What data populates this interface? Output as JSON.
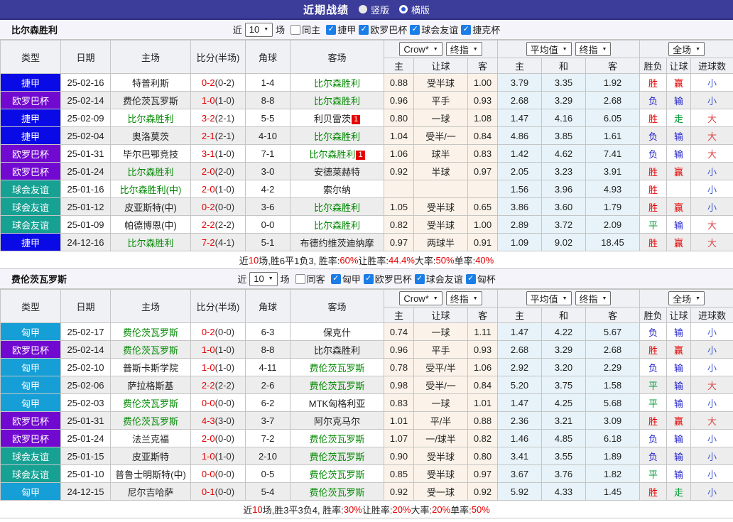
{
  "titlebar": {
    "title": "近期战绩",
    "radio_vertical": "竖版",
    "radio_horizontal": "横版",
    "selected": "横版"
  },
  "palette": {
    "titlebar_bg": "#3c3c9a",
    "focal_green": "#008800",
    "score_red": "#e60000",
    "checkbox_blue": "#1b7de6",
    "handicap_bg": "#fbf3e9",
    "avg_bg": "#e7f3f9"
  },
  "type_colors": {
    "捷甲": "#0a0ae6",
    "欧罗巴杯": "#7209d0",
    "球会友谊": "#16a193",
    "匈甲": "#169fd6"
  },
  "result_colors": {
    "胜": "#e60000",
    "赢": "#e60000",
    "大": "#e04545",
    "负": "#2222cc",
    "输": "#2222cc",
    "小": "#3b55d4",
    "平": "#009933",
    "走": "#009933"
  },
  "table_headers": {
    "type": "类型",
    "date": "日期",
    "home": "主场",
    "score": "比分(半场)",
    "corner": "角球",
    "away": "客场",
    "selects": {
      "crow": "Crow*",
      "final1": "终指",
      "avg": "平均值",
      "final2": "终指",
      "full": "全场"
    },
    "sub": [
      "主",
      "让球",
      "客",
      "主",
      "和",
      "客",
      "胜负",
      "让球",
      "进球数"
    ]
  },
  "filter_labels": {
    "near": "近",
    "count": "10",
    "matches": "场"
  },
  "sections": [
    {
      "team": "比尔森胜利",
      "filter": {
        "same_label": "同主",
        "same_checked": false,
        "leagues": [
          {
            "label": "捷甲",
            "checked": true
          },
          {
            "label": "欧罗巴杯",
            "checked": true
          },
          {
            "label": "球会友谊",
            "checked": true
          },
          {
            "label": "捷克杯",
            "checked": true
          }
        ]
      },
      "rows": [
        {
          "type": "捷甲",
          "date": "25-02-16",
          "home": "特普利斯",
          "home_focal": false,
          "score": "0-2",
          "half": "(0-2)",
          "corner": "1-4",
          "away": "比尔森胜利",
          "away_focal": true,
          "away_badge": "",
          "odds": [
            "0.88",
            "受半球",
            "1.00"
          ],
          "avg": [
            "3.79",
            "3.35",
            "1.92"
          ],
          "results": [
            "胜",
            "赢",
            "小"
          ]
        },
        {
          "type": "欧罗巴杯",
          "date": "25-02-14",
          "home": "费伦茨瓦罗斯",
          "home_focal": false,
          "score": "1-0",
          "half": "(1-0)",
          "corner": "8-8",
          "away": "比尔森胜利",
          "away_focal": true,
          "away_badge": "",
          "odds": [
            "0.96",
            "平手",
            "0.93"
          ],
          "avg": [
            "2.68",
            "3.29",
            "2.68"
          ],
          "results": [
            "负",
            "输",
            "小"
          ]
        },
        {
          "type": "捷甲",
          "date": "25-02-09",
          "home": "比尔森胜利",
          "home_focal": true,
          "score": "3-2",
          "half": "(2-1)",
          "corner": "5-5",
          "away": "利贝雷茨",
          "away_focal": false,
          "away_badge": "1",
          "odds": [
            "0.80",
            "一球",
            "1.08"
          ],
          "avg": [
            "1.47",
            "4.16",
            "6.05"
          ],
          "results": [
            "胜",
            "走",
            "大"
          ]
        },
        {
          "type": "捷甲",
          "date": "25-02-04",
          "home": "奥洛莫茨",
          "home_focal": false,
          "score": "2-1",
          "half": "(2-1)",
          "corner": "4-10",
          "away": "比尔森胜利",
          "away_focal": true,
          "away_badge": "",
          "odds": [
            "1.04",
            "受半/一",
            "0.84"
          ],
          "avg": [
            "4.86",
            "3.85",
            "1.61"
          ],
          "results": [
            "负",
            "输",
            "大"
          ]
        },
        {
          "type": "欧罗巴杯",
          "date": "25-01-31",
          "home": "毕尔巴鄂竞技",
          "home_focal": false,
          "score": "3-1",
          "half": "(1-0)",
          "corner": "7-1",
          "away": "比尔森胜利",
          "away_focal": true,
          "away_badge": "1",
          "odds": [
            "1.06",
            "球半",
            "0.83"
          ],
          "avg": [
            "1.42",
            "4.62",
            "7.41"
          ],
          "results": [
            "负",
            "输",
            "大"
          ]
        },
        {
          "type": "欧罗巴杯",
          "date": "25-01-24",
          "home": "比尔森胜利",
          "home_focal": true,
          "score": "2-0",
          "half": "(2-0)",
          "corner": "3-0",
          "away": "安德莱赫特",
          "away_focal": false,
          "away_badge": "",
          "odds": [
            "0.92",
            "半球",
            "0.97"
          ],
          "avg": [
            "2.05",
            "3.23",
            "3.91"
          ],
          "results": [
            "胜",
            "赢",
            "小"
          ]
        },
        {
          "type": "球会友谊",
          "date": "25-01-16",
          "home": "比尔森胜利(中)",
          "home_focal": true,
          "score": "2-0",
          "half": "(1-0)",
          "corner": "4-2",
          "away": "索尔纳",
          "away_focal": false,
          "away_badge": "",
          "odds": [
            "",
            "",
            ""
          ],
          "avg": [
            "1.56",
            "3.96",
            "4.93"
          ],
          "results": [
            "胜",
            "",
            "小"
          ]
        },
        {
          "type": "球会友谊",
          "date": "25-01-12",
          "home": "皮亚斯特(中)",
          "home_focal": false,
          "score": "0-2",
          "half": "(0-0)",
          "corner": "3-6",
          "away": "比尔森胜利",
          "away_focal": true,
          "away_badge": "",
          "odds": [
            "1.05",
            "受半球",
            "0.65"
          ],
          "avg": [
            "3.86",
            "3.60",
            "1.79"
          ],
          "results": [
            "胜",
            "赢",
            "小"
          ]
        },
        {
          "type": "球会友谊",
          "date": "25-01-09",
          "home": "帕德博恩(中)",
          "home_focal": false,
          "score": "2-2",
          "half": "(2-2)",
          "corner": "0-0",
          "away": "比尔森胜利",
          "away_focal": true,
          "away_badge": "",
          "odds": [
            "0.82",
            "受半球",
            "1.00"
          ],
          "avg": [
            "2.89",
            "3.72",
            "2.09"
          ],
          "results": [
            "平",
            "输",
            "大"
          ]
        },
        {
          "type": "捷甲",
          "date": "24-12-16",
          "home": "比尔森胜利",
          "home_focal": true,
          "score": "7-2",
          "half": "(4-1)",
          "corner": "5-1",
          "away": "布德约维茨迪纳摩",
          "away_focal": false,
          "away_badge": "",
          "odds": [
            "0.97",
            "两球半",
            "0.91"
          ],
          "avg": [
            "1.09",
            "9.02",
            "18.45"
          ],
          "results": [
            "胜",
            "赢",
            "大"
          ]
        }
      ],
      "summary": [
        {
          "text": "近",
          "red": false
        },
        {
          "text": "10",
          "red": true
        },
        {
          "text": "场,胜6平1负3, 胜率:",
          "red": false
        },
        {
          "text": "60%",
          "red": true
        },
        {
          "text": " 让胜率:",
          "red": false
        },
        {
          "text": "44.4%",
          "red": true
        },
        {
          "text": " 大率:",
          "red": false
        },
        {
          "text": "50%",
          "red": true
        },
        {
          "text": " 单率:",
          "red": false
        },
        {
          "text": "40%",
          "red": true
        }
      ]
    },
    {
      "team": "费伦茨瓦罗斯",
      "filter": {
        "same_label": "同客",
        "same_checked": false,
        "leagues": [
          {
            "label": "匈甲",
            "checked": true
          },
          {
            "label": "欧罗巴杯",
            "checked": true
          },
          {
            "label": "球会友谊",
            "checked": true
          },
          {
            "label": "匈杯",
            "checked": true
          }
        ]
      },
      "rows": [
        {
          "type": "匈甲",
          "date": "25-02-17",
          "home": "费伦茨瓦罗斯",
          "home_focal": true,
          "score": "0-2",
          "half": "(0-0)",
          "corner": "6-3",
          "away": "保克什",
          "away_focal": false,
          "away_badge": "",
          "odds": [
            "0.74",
            "一球",
            "1.11"
          ],
          "avg": [
            "1.47",
            "4.22",
            "5.67"
          ],
          "results": [
            "负",
            "输",
            "小"
          ]
        },
        {
          "type": "欧罗巴杯",
          "date": "25-02-14",
          "home": "费伦茨瓦罗斯",
          "home_focal": true,
          "score": "1-0",
          "half": "(1-0)",
          "corner": "8-8",
          "away": "比尔森胜利",
          "away_focal": false,
          "away_badge": "",
          "odds": [
            "0.96",
            "平手",
            "0.93"
          ],
          "avg": [
            "2.68",
            "3.29",
            "2.68"
          ],
          "results": [
            "胜",
            "赢",
            "小"
          ]
        },
        {
          "type": "匈甲",
          "date": "25-02-10",
          "home": "普斯卡斯学院",
          "home_focal": false,
          "score": "1-0",
          "half": "(1-0)",
          "corner": "4-11",
          "away": "费伦茨瓦罗斯",
          "away_focal": true,
          "away_badge": "",
          "odds": [
            "0.78",
            "受平/半",
            "1.06"
          ],
          "avg": [
            "2.92",
            "3.20",
            "2.29"
          ],
          "results": [
            "负",
            "输",
            "小"
          ]
        },
        {
          "type": "匈甲",
          "date": "25-02-06",
          "home": "萨拉格斯基",
          "home_focal": false,
          "score": "2-2",
          "half": "(2-2)",
          "corner": "2-6",
          "away": "费伦茨瓦罗斯",
          "away_focal": true,
          "away_badge": "",
          "odds": [
            "0.98",
            "受半/一",
            "0.84"
          ],
          "avg": [
            "5.20",
            "3.75",
            "1.58"
          ],
          "results": [
            "平",
            "输",
            "大"
          ]
        },
        {
          "type": "匈甲",
          "date": "25-02-03",
          "home": "费伦茨瓦罗斯",
          "home_focal": true,
          "score": "0-0",
          "half": "(0-0)",
          "corner": "6-2",
          "away": "MTK匈格利亚",
          "away_focal": false,
          "away_badge": "",
          "odds": [
            "0.83",
            "一球",
            "1.01"
          ],
          "avg": [
            "1.47",
            "4.25",
            "5.68"
          ],
          "results": [
            "平",
            "输",
            "小"
          ]
        },
        {
          "type": "欧罗巴杯",
          "date": "25-01-31",
          "home": "费伦茨瓦罗斯",
          "home_focal": true,
          "score": "4-3",
          "half": "(3-0)",
          "corner": "3-7",
          "away": "阿尔克马尔",
          "away_focal": false,
          "away_badge": "",
          "odds": [
            "1.01",
            "平/半",
            "0.88"
          ],
          "avg": [
            "2.36",
            "3.21",
            "3.09"
          ],
          "results": [
            "胜",
            "赢",
            "大"
          ]
        },
        {
          "type": "欧罗巴杯",
          "date": "25-01-24",
          "home": "法兰克福",
          "home_focal": false,
          "score": "2-0",
          "half": "(0-0)",
          "corner": "7-2",
          "away": "费伦茨瓦罗斯",
          "away_focal": true,
          "away_badge": "",
          "odds": [
            "1.07",
            "一/球半",
            "0.82"
          ],
          "avg": [
            "1.46",
            "4.85",
            "6.18"
          ],
          "results": [
            "负",
            "输",
            "小"
          ]
        },
        {
          "type": "球会友谊",
          "date": "25-01-15",
          "home": "皮亚斯特",
          "home_focal": false,
          "score": "1-0",
          "half": "(1-0)",
          "corner": "2-10",
          "away": "费伦茨瓦罗斯",
          "away_focal": true,
          "away_badge": "",
          "odds": [
            "0.90",
            "受半球",
            "0.80"
          ],
          "avg": [
            "3.41",
            "3.55",
            "1.89"
          ],
          "results": [
            "负",
            "输",
            "小"
          ]
        },
        {
          "type": "球会友谊",
          "date": "25-01-10",
          "home": "普鲁士明斯特(中)",
          "home_focal": false,
          "score": "0-0",
          "half": "(0-0)",
          "corner": "0-5",
          "away": "费伦茨瓦罗斯",
          "away_focal": true,
          "away_badge": "",
          "odds": [
            "0.85",
            "受半球",
            "0.97"
          ],
          "avg": [
            "3.67",
            "3.76",
            "1.82"
          ],
          "results": [
            "平",
            "输",
            "小"
          ]
        },
        {
          "type": "匈甲",
          "date": "24-12-15",
          "home": "尼尔吉哈萨",
          "home_focal": false,
          "score": "0-1",
          "half": "(0-0)",
          "corner": "5-4",
          "away": "费伦茨瓦罗斯",
          "away_focal": true,
          "away_badge": "",
          "odds": [
            "0.92",
            "受一球",
            "0.92"
          ],
          "avg": [
            "5.92",
            "4.33",
            "1.45"
          ],
          "results": [
            "胜",
            "走",
            "小"
          ]
        }
      ],
      "summary": [
        {
          "text": "近",
          "red": false
        },
        {
          "text": "10",
          "red": true
        },
        {
          "text": "场,胜3平3负4, 胜率:",
          "red": false
        },
        {
          "text": "30%",
          "red": true
        },
        {
          "text": " 让胜率:",
          "red": false
        },
        {
          "text": "20%",
          "red": true
        },
        {
          "text": " 大率:",
          "red": false
        },
        {
          "text": "20%",
          "red": true
        },
        {
          "text": " 单率:",
          "red": false
        },
        {
          "text": "50%",
          "red": true
        }
      ]
    }
  ]
}
